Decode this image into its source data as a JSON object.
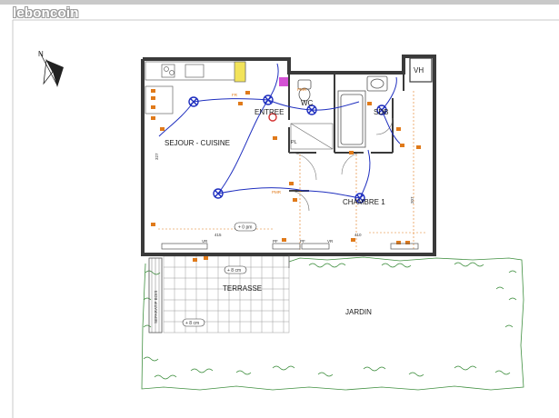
{
  "watermark": "leboncoin",
  "compass": {
    "north_label": "N"
  },
  "rooms": {
    "sejour": "SEJOUR - CUISINE",
    "entree": "ENTREE",
    "wc": "WC",
    "sdb": "SDB",
    "chambre": "CHAMBRE 1",
    "terrasse": "TERRASSE",
    "jardin": "JARDIN",
    "vh": "VH",
    "pl": "PL",
    "separatif": "SEPARATIF BOIS"
  },
  "levels": {
    "interior": "+ 0 pm",
    "terrasse_top": "+ 8 cm",
    "terrasse_bottom": "+ 8 cm"
  },
  "labels": {
    "vr1": "VR",
    "vr2": "VR",
    "pf1": "PF",
    "pf2": "PF",
    "dim1": "415",
    "dim2": "410",
    "dim3": "327",
    "dim4": "207",
    "pmr1": "PMR",
    "pmr2": "PMR",
    "fr": "FR",
    "vh_note": "VH"
  },
  "colors": {
    "wall": "#3a3a3a",
    "electric": "#1f2fbf",
    "annotation": "#e07a1a",
    "garden": "#3f8f3f",
    "accent_pink": "#cc33cc"
  }
}
